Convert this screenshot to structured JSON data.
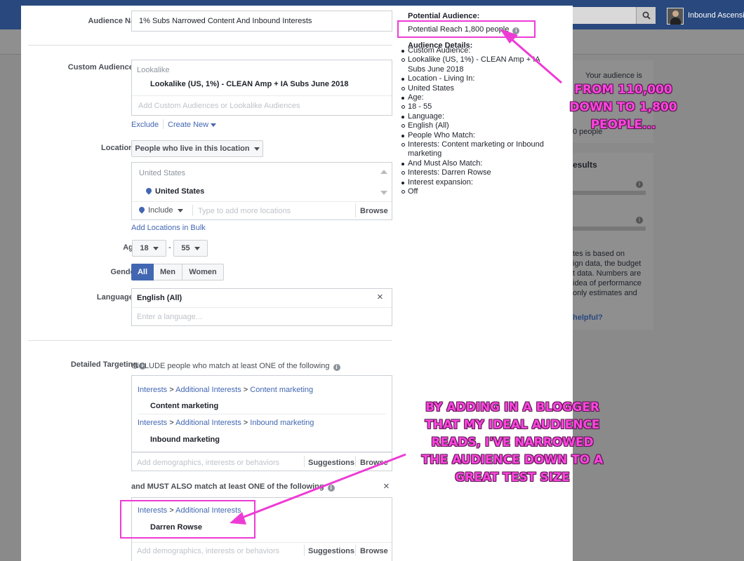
{
  "background": {
    "username": "Inbound Ascension",
    "panel_text": [
      "Your audience is",
      "0 people"
    ],
    "results_heading": "esults",
    "disclaimer_lines": [
      "tes is based on",
      "ign data, the budget",
      "t data. Numbers are",
      "idea of performance",
      "only estimates and"
    ],
    "helpful_link": "helpful?"
  },
  "form": {
    "audience_name": {
      "label": "Audience Name",
      "value": "1% Subs Narrowed Content And Inbound Interests"
    },
    "custom_audiences": {
      "label": "Custom Audiences",
      "group_header": "Lookalike",
      "item": "Lookalike (US, 1%) - CLEAN Amp + IA Subs June 2018",
      "placeholder": "Add Custom Audiences or Lookalike Audiences",
      "exclude_link": "Exclude",
      "create_new_link": "Create New"
    },
    "locations": {
      "label": "Locations",
      "dropdown": "People who live in this location",
      "group_header": "United States",
      "item": "United States",
      "include_select": "Include",
      "placeholder": "Type to add more locations",
      "browse": "Browse",
      "bulk_link": "Add Locations in Bulk"
    },
    "age": {
      "label": "Age",
      "min": "18",
      "max": "55",
      "separator": "-"
    },
    "gender": {
      "label": "Gender",
      "options": [
        "All",
        "Men",
        "Women"
      ],
      "selected": "All"
    },
    "languages": {
      "label": "Languages",
      "value": "English (All)",
      "placeholder": "Enter a language..."
    },
    "detailed_targeting": {
      "label": "Detailed Targeting",
      "include_text": "INCLUDE people who match at least ONE of the following",
      "include_items": [
        {
          "crumb_1": "Interests",
          "crumb_2": "Additional Interests",
          "crumb_3": "Content marketing",
          "name": "Content marketing"
        },
        {
          "crumb_1": "Interests",
          "crumb_2": "Additional Interests",
          "crumb_3": "Inbound marketing",
          "name": "Inbound marketing"
        }
      ],
      "crumb_sep": ">",
      "placeholder": "Add demographics, interests or behaviors",
      "suggestions": "Suggestions",
      "browse": "Browse",
      "must_also_text": "and MUST ALSO match at least ONE of the following",
      "must_item": {
        "crumb_1": "Interests",
        "crumb_2": "Additional Interests",
        "name": "Darren Rowse"
      }
    }
  },
  "summary": {
    "potential_heading": "Potential Audience:",
    "potential_reach": "Potential Reach 1,800 people",
    "details_heading": "Audience Details:",
    "details": [
      {
        "type": "bullet",
        "text": "Custom Audience:"
      },
      {
        "type": "circle",
        "text": "Lookalike (US, 1%) - CLEAN Amp + IA Subs June 2018"
      },
      {
        "type": "bullet",
        "text": "Location - Living In:"
      },
      {
        "type": "circle",
        "text": "United States"
      },
      {
        "type": "bullet",
        "text": "Age:"
      },
      {
        "type": "circle",
        "text": "18 - 55"
      },
      {
        "type": "bullet",
        "text": "Language:"
      },
      {
        "type": "circle",
        "text": "English (All)"
      },
      {
        "type": "bullet",
        "text": "People Who Match:"
      },
      {
        "type": "circle",
        "text": "Interests: Content marketing or Inbound marketing"
      },
      {
        "type": "bullet",
        "text": "And Must Also Match:"
      },
      {
        "type": "circle",
        "text": "Interests: Darren Rowse"
      },
      {
        "type": "bullet",
        "text": "Interest expansion:"
      },
      {
        "type": "circle",
        "text": "Off"
      }
    ]
  },
  "annotations": {
    "top": [
      "FROM 110,000",
      "DOWN TO 1,800",
      "PEOPLE..."
    ],
    "bottom": [
      "BY ADDING IN A BLOGGER",
      "THAT MY IDEAL AUDIENCE",
      "READS, I'VE NARROWED",
      "THE AUDIENCE DOWN TO A",
      "GREAT TEST SIZE"
    ],
    "color": "#ff44e0"
  },
  "colors": {
    "accent": "#4267b2",
    "topbar": "#29487d",
    "highlight": "#ee3bd5"
  }
}
